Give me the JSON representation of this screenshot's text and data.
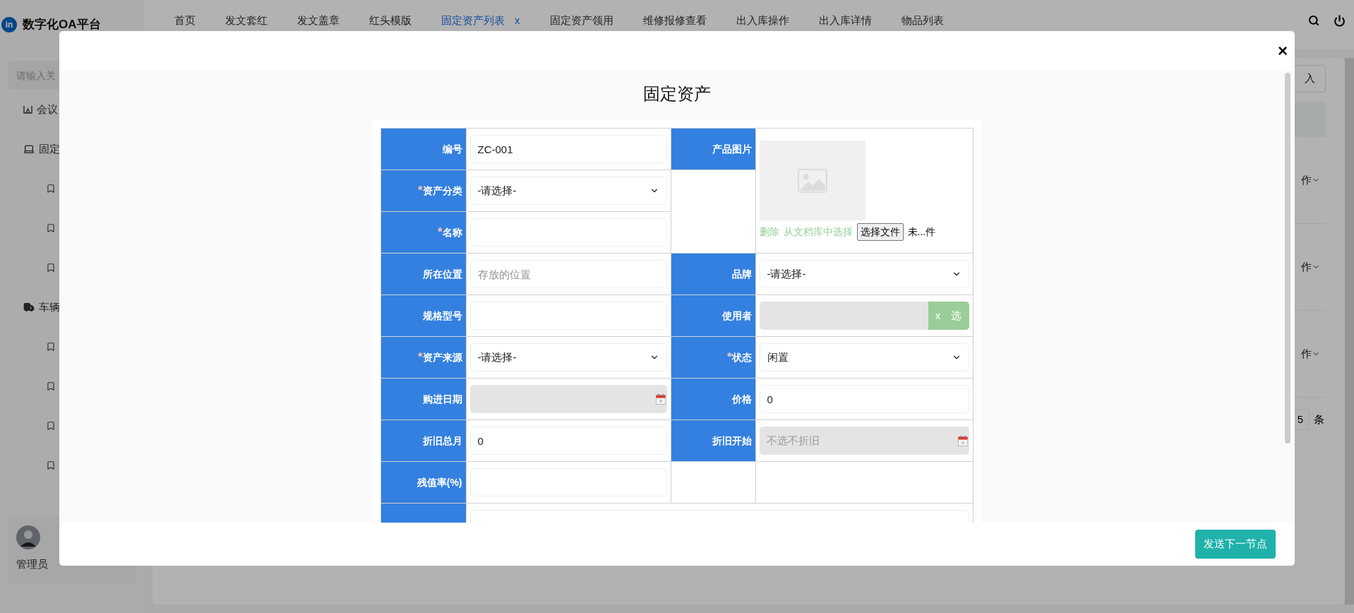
{
  "app": {
    "logo_text": "in",
    "title": "数字化OA平台",
    "nav_tabs": [
      {
        "label": "首页",
        "selected": false
      },
      {
        "label": "发文套红",
        "selected": false
      },
      {
        "label": "发文盖章",
        "selected": false
      },
      {
        "label": "红头模版",
        "selected": false
      },
      {
        "label": "固定资产列表",
        "selected": true,
        "close_label": "x"
      },
      {
        "label": "固定资产领用",
        "selected": false
      },
      {
        "label": "维修报修查看",
        "selected": false
      },
      {
        "label": "出入库操作",
        "selected": false
      },
      {
        "label": "出入库详情",
        "selected": false
      },
      {
        "label": "物品列表",
        "selected": false
      }
    ]
  },
  "sidebar": {
    "search_placeholder": "请输入关",
    "items": [
      {
        "kind": "meeting",
        "label": "会议"
      },
      {
        "kind": "laptop",
        "label": "固定",
        "children": [
          {
            "kind": "bookmark"
          },
          {
            "kind": "bookmark"
          },
          {
            "kind": "bookmark"
          }
        ]
      },
      {
        "kind": "truck",
        "label": "车辆",
        "children": [
          {
            "kind": "bookmark"
          },
          {
            "kind": "bookmark"
          },
          {
            "kind": "bookmark"
          },
          {
            "kind": "bookmark"
          }
        ]
      }
    ],
    "user": {
      "name": "管理员"
    }
  },
  "background": {
    "import_button": "入",
    "row_actions": [
      "作",
      "作",
      "作"
    ],
    "page_size": "5",
    "page_size_unit": "条"
  },
  "modal": {
    "close": "×",
    "title": "固定资产",
    "rows": [
      {
        "left": {
          "label": "编号",
          "kind": "input",
          "value": "ZC-001"
        },
        "right": {
          "label": "产品图片",
          "kind": "image",
          "delete_link": "删除",
          "library_link": "从文档库中选择",
          "file_button": "选择文件",
          "file_status": "未...件"
        }
      },
      {
        "left": {
          "label": "资产分类",
          "required_mark": "*",
          "kind": "select",
          "value": "-请选择-"
        }
      },
      {
        "left": {
          "label": "名称",
          "required_mark": "*",
          "kind": "input"
        }
      },
      {
        "left": {
          "label": "所在位置",
          "kind": "input",
          "placeholder": "存放的位置"
        },
        "right": {
          "label": "品牌",
          "kind": "select",
          "value": "-请选择-"
        }
      },
      {
        "left": {
          "label": "规格型号",
          "kind": "input"
        },
        "right": {
          "label": "使用者",
          "kind": "picker",
          "clear_label": "x",
          "pick_label": "选"
        }
      },
      {
        "left": {
          "label": "资产来源",
          "required_mark": "*",
          "kind": "select",
          "value": "-请选择-"
        },
        "right": {
          "label": "状态",
          "required_mark": "*",
          "kind": "select",
          "value": "闲置"
        }
      },
      {
        "left": {
          "label": "购进日期",
          "kind": "date"
        },
        "right": {
          "label": "价格",
          "kind": "input",
          "value": "0"
        }
      },
      {
        "left": {
          "label": "折旧总月",
          "kind": "input",
          "value": "0"
        },
        "right": {
          "label": "折旧开始",
          "kind": "date",
          "placeholder": "不选不折旧"
        }
      },
      {
        "left": {
          "label": "残值率(%)",
          "kind": "input"
        },
        "right": {
          "kind": "blank"
        }
      },
      {
        "left": {
          "kind": "wide_input"
        }
      }
    ],
    "submit_button": "发送下一节点"
  }
}
